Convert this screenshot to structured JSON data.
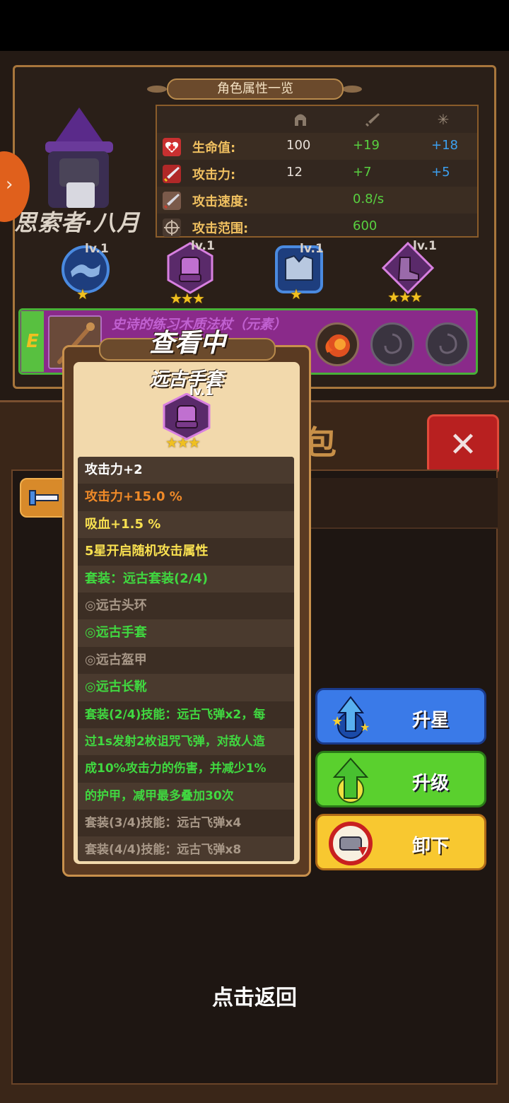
{
  "character_panel": {
    "title": "角色属性一览",
    "name": "思索者·八月",
    "stats_header": {
      "base_icon": "helmet-icon",
      "equip_icon": "sword-icon",
      "extra_icon": "sparkle-icon"
    },
    "stats": [
      {
        "icon": "heart-icon",
        "label": "生命值:",
        "base": "100",
        "equip": "+19",
        "extra": "+18"
      },
      {
        "icon": "sword-attack-icon",
        "label": "攻击力:",
        "base": "12",
        "equip": "+7",
        "extra": "+5"
      },
      {
        "icon": "attack-speed-icon",
        "label": "攻击速度:",
        "base": "",
        "equip": "0.8/s",
        "extra": ""
      },
      {
        "icon": "crosshair-icon",
        "label": "攻击范围:",
        "base": "",
        "equip": "600",
        "extra": ""
      }
    ],
    "slots": [
      {
        "icon": "amulet-icon",
        "level": "lv.1",
        "stars": "★"
      },
      {
        "icon": "gauntlet-icon",
        "level": "lv.1",
        "stars": "★★★"
      },
      {
        "icon": "armor-icon",
        "level": "lv.1",
        "stars": "★"
      },
      {
        "icon": "boots-icon",
        "level": "lv.1",
        "stars": "★★★"
      }
    ],
    "weapon": {
      "grade": "E",
      "name": "史诗的练习木质法杖（元素）"
    },
    "side_arrow": "›"
  },
  "bag": {
    "title": "包",
    "close": "✕"
  },
  "popup": {
    "status": "查看中",
    "item_name": "远古手套",
    "item_level": "lv.1",
    "item_stars": "★★★",
    "attributes": [
      {
        "text": "攻击力+2",
        "color": "white"
      },
      {
        "text": "攻击力+15.0 %",
        "color": "orange"
      },
      {
        "text": "吸血+1.5 %",
        "color": "yellow"
      },
      {
        "text": "5星开启随机攻击属性",
        "color": "yellow"
      },
      {
        "text": "套装：远古套装(2/4)",
        "color": "green"
      },
      {
        "text": "◎远古头环",
        "color": "gray"
      },
      {
        "text": "◎远古手套",
        "color": "green"
      },
      {
        "text": "◎远古盔甲",
        "color": "gray"
      },
      {
        "text": "◎远古长靴",
        "color": "green"
      }
    ],
    "skill_lines": [
      "套装(2/4)技能：远古飞弹x2，每",
      "过1s发射2枚诅咒飞弹，对敌人造",
      "成10%攻击力的伤害，并减少1%",
      "的护甲，减甲最多叠加30次"
    ],
    "locked_skills": [
      "套装(3/4)技能：远古飞弹x4",
      "套装(4/4)技能：远古飞弹x8"
    ]
  },
  "actions": {
    "star_up": "升星",
    "level_up": "升级",
    "unequip": "卸下"
  },
  "footer": {
    "back": "点击返回"
  }
}
